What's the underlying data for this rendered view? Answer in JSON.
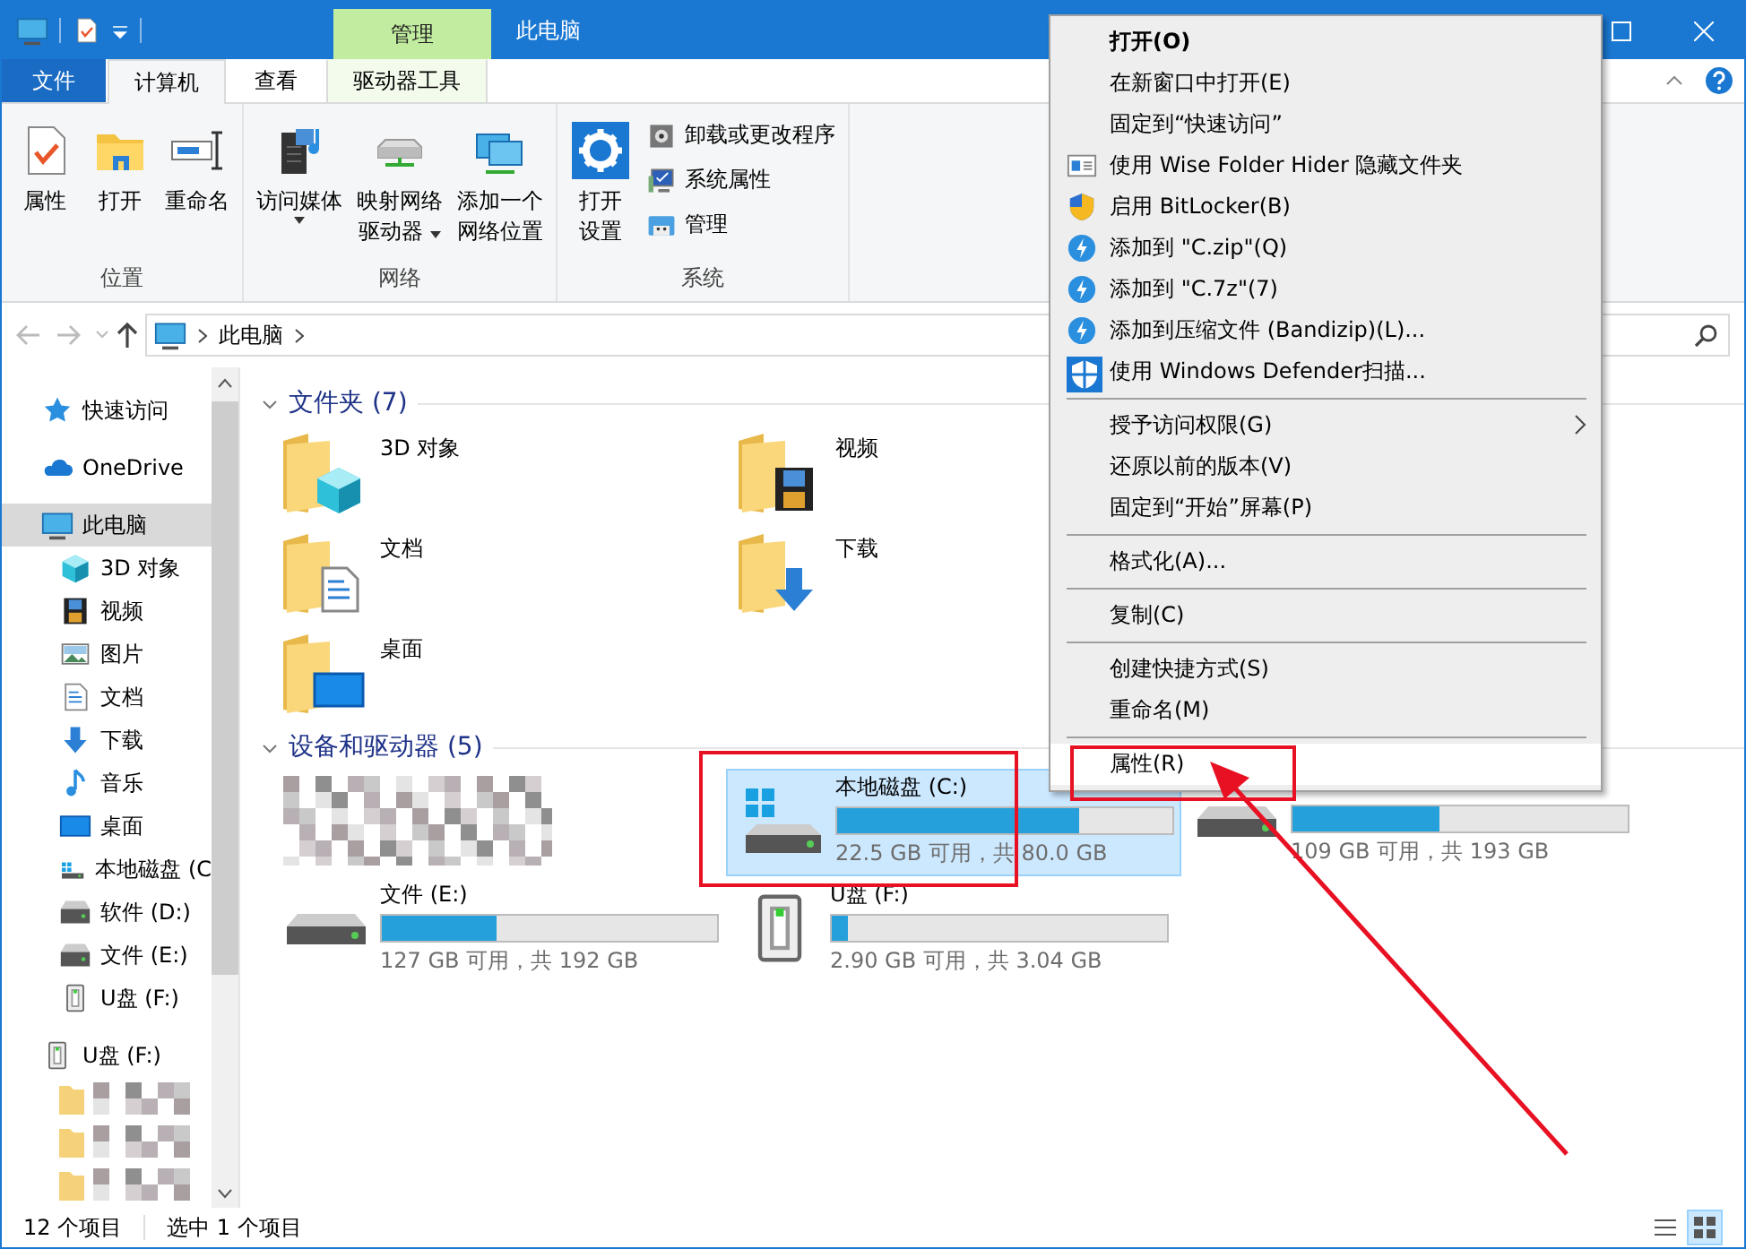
{
  "title_bar": {
    "context_tab": "管理",
    "title": "此电脑"
  },
  "ribbon": {
    "tabs": [
      {
        "label": "文件",
        "kind": "file",
        "selected": false
      },
      {
        "label": "计算机",
        "kind": "tab",
        "selected": true
      },
      {
        "label": "查看",
        "kind": "tab",
        "selected": false
      },
      {
        "label": "驱动器工具",
        "kind": "tab",
        "selected": false
      }
    ],
    "groups": [
      {
        "label": "位置",
        "buttons": [
          {
            "kind": "large",
            "lines": [
              "属性"
            ],
            "dropdown": false
          },
          {
            "kind": "large",
            "lines": [
              "打开"
            ],
            "dropdown": false
          },
          {
            "kind": "large",
            "lines": [
              "重命名"
            ],
            "dropdown": false
          }
        ]
      },
      {
        "label": "网络",
        "buttons": [
          {
            "kind": "large",
            "lines": [
              "访问媒体"
            ],
            "dropdown": true
          },
          {
            "kind": "large",
            "lines": [
              "映射网络",
              "驱动器"
            ],
            "dropdown": true
          },
          {
            "kind": "large",
            "lines": [
              "添加一个",
              "网络位置"
            ],
            "dropdown": false
          }
        ]
      },
      {
        "label": "系统",
        "buttons": [
          {
            "kind": "large",
            "lines": [
              "打开",
              "设置"
            ],
            "dropdown": false
          },
          {
            "kind": "small",
            "lines": [
              "卸载或更改程序"
            ],
            "dropdown": false
          },
          {
            "kind": "small",
            "lines": [
              "系统属性"
            ],
            "dropdown": false
          },
          {
            "kind": "small",
            "lines": [
              "管理"
            ],
            "dropdown": false
          }
        ]
      }
    ]
  },
  "address_bar": {
    "path": "此电脑"
  },
  "sidebar": {
    "items": [
      {
        "label": "快速访问",
        "kind": "quickaccess",
        "selected": false
      },
      {
        "label": "OneDrive",
        "kind": "onedrive",
        "selected": false
      },
      {
        "label": "此电脑",
        "kind": "computer",
        "selected": true,
        "children": [
          {
            "label": "3D 对象",
            "kind": "objects",
            "selected": false
          },
          {
            "label": "视频",
            "kind": "videos",
            "selected": false
          },
          {
            "label": "图片",
            "kind": "pictures",
            "selected": false
          },
          {
            "label": "文档",
            "kind": "documents",
            "selected": false
          },
          {
            "label": "下载",
            "kind": "downloads",
            "selected": false
          },
          {
            "label": "音乐",
            "kind": "music",
            "selected": false
          },
          {
            "label": "桌面",
            "kind": "desktop",
            "selected": false
          },
          {
            "label": "本地磁盘 (C",
            "kind": "systemdrive",
            "selected": false
          },
          {
            "label": "软件 (D:)",
            "kind": "drive",
            "selected": false
          },
          {
            "label": "文件 (E:)",
            "kind": "drive",
            "selected": false
          },
          {
            "label": "U盘 (F:)",
            "kind": "usb",
            "selected": false
          }
        ]
      },
      {
        "label": "U盘 (F:)",
        "kind": "usb",
        "selected": false,
        "children": [
          {
            "kind": "pixelated"
          },
          {
            "kind": "pixelated"
          },
          {
            "kind": "pixelated"
          }
        ]
      }
    ]
  },
  "sections": [
    {
      "title": "文件夹 (7)",
      "kind": "folders",
      "expanded": true,
      "items": [
        {
          "kind": "objects",
          "name": "3D 对象"
        },
        {
          "kind": "videos",
          "name": "视频"
        },
        {
          "kind": "documents",
          "name": "文档"
        },
        {
          "kind": "downloads",
          "name": "下载"
        },
        {
          "kind": "desktop",
          "name": "桌面"
        }
      ]
    },
    {
      "title": "设备和驱动器 (5)",
      "kind": "drives",
      "expanded": true,
      "items": [
        {
          "kind": "pixelated"
        },
        {
          "kind": "systemdrive",
          "name": "本地磁盘 (C:)",
          "level": 0.72,
          "space": "22.5 GB 可用，共 80.0 GB",
          "selected": true
        },
        {
          "kind": "drive",
          "level": 0.44,
          "space": "109 GB 可用，共 193 GB",
          "selected": false
        },
        {
          "kind": "drive",
          "name": "文件 (E:)",
          "level": 0.34,
          "space": "127 GB 可用，共 192 GB",
          "selected": false
        },
        {
          "kind": "usb",
          "name": "U盘 (F:)",
          "level": 0.05,
          "space": "2.90 GB 可用，共 3.04 GB",
          "selected": false
        }
      ]
    }
  ],
  "status_bar": {
    "item_count": "12 个项目",
    "selection": "选中 1 个项目",
    "views": [
      {
        "kind": "details",
        "selected": false
      },
      {
        "kind": "tiles",
        "selected": true
      }
    ]
  },
  "context_menu": {
    "groups": [
      [
        {
          "label": "打开(O)",
          "bold": true,
          "selected": false
        },
        {
          "label": "在新窗口中打开(E)",
          "bold": false,
          "selected": false
        },
        {
          "label": "固定到“快速访问”",
          "bold": false,
          "selected": false
        },
        {
          "label": "使用 Wise Folder Hider 隐藏文件夹",
          "bold": false,
          "selected": false
        },
        {
          "label": "启用 BitLocker(B)",
          "bold": false,
          "selected": false
        },
        {
          "label": "添加到 \"C.zip\"(Q)",
          "bold": false,
          "selected": false
        },
        {
          "label": "添加到 \"C.7z\"(7)",
          "bold": false,
          "selected": false
        },
        {
          "label": "添加到压缩文件 (Bandizip)(L)...",
          "bold": false,
          "selected": false
        },
        {
          "label": "使用 Windows Defender扫描...",
          "bold": false,
          "selected": false
        }
      ],
      [
        {
          "label": "授予访问权限(G)",
          "bold": false,
          "submenu": true,
          "selected": false
        },
        {
          "label": "还原以前的版本(V)",
          "bold": false,
          "selected": false
        },
        {
          "label": "固定到“开始”屏幕(P)",
          "bold": false,
          "selected": false
        }
      ],
      [
        {
          "label": "格式化(A)...",
          "bold": false,
          "selected": false
        }
      ],
      [
        {
          "label": "复制(C)",
          "bold": false,
          "selected": false
        }
      ],
      [
        {
          "label": "创建快捷方式(S)",
          "bold": false,
          "selected": false
        },
        {
          "label": "重命名(M)",
          "bold": false,
          "selected": false
        }
      ],
      [
        {
          "label": "属性(R)",
          "bold": false,
          "selected": true
        }
      ]
    ]
  }
}
